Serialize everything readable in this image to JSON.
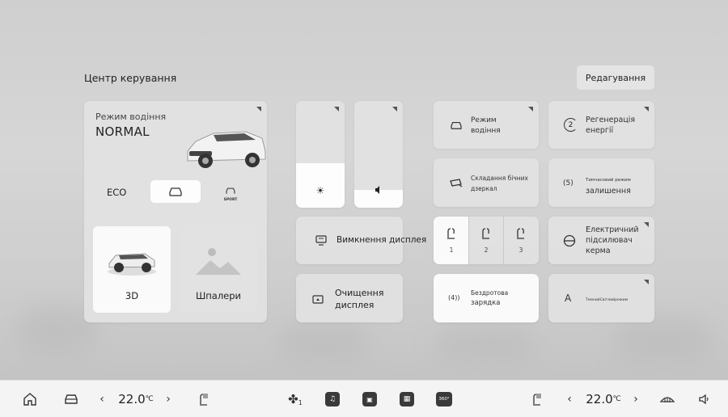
{
  "header": {
    "title": "Центр керування",
    "edit_label": "Редагування"
  },
  "mode_panel": {
    "label": "Режим водіння",
    "value": "NORMAL",
    "eco_label": "ECO",
    "sport_label": "SPORT",
    "card_3d_label": "3D",
    "card_wallpaper_label": "Шпалери"
  },
  "sliders": {
    "brightness_level": 0.42,
    "volume_level": 0.17
  },
  "wide_tiles": {
    "display_off_label": "Вимкнення дисплея",
    "clean_display_label_1": "Очищення",
    "clean_display_label_2": "дисплея"
  },
  "tiles": {
    "drive_mode_1": "Режим",
    "drive_mode_2": "водіння",
    "fold_mirrors_1": "Складання бічних",
    "fold_mirrors_2": "дзеркал",
    "wireless_charge_1": "Бездротова",
    "wireless_charge_2": "зарядка",
    "wireless_charge_icon": "(4))",
    "regen_1": "Регенерація",
    "regen_2": "енергії",
    "regen_icon": "2",
    "temp_mode_1": "Тимчасовий режим",
    "temp_mode_2": "залишення",
    "temp_mode_icon": "(5)",
    "steering_1": "Електричний",
    "steering_2": "підсилювач",
    "steering_3": "керма",
    "theme_icon": "A",
    "theme_label": "ТемнийСвітлийрежим"
  },
  "seat_positions": [
    "1",
    "2",
    "3"
  ],
  "bottom_bar": {
    "left_temp": "22.0",
    "right_temp": "22.0",
    "temp_unit": "℃",
    "fan_level": "1",
    "cam_label": "360°"
  }
}
